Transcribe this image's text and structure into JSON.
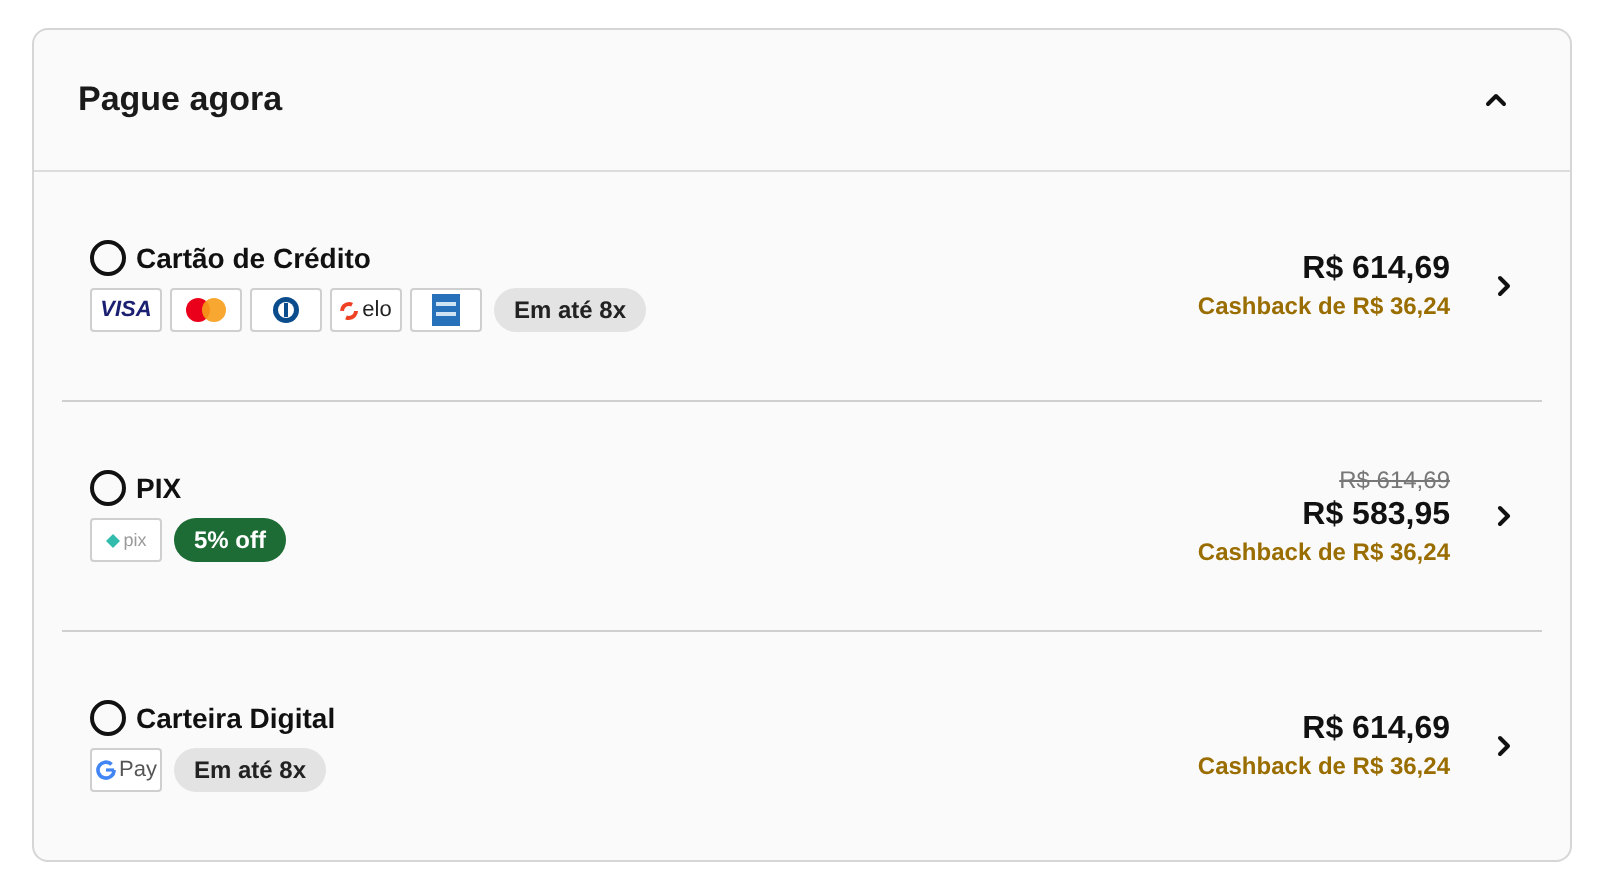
{
  "panel": {
    "title": "Pague agora",
    "expanded": true
  },
  "methods": [
    {
      "name": "Cartão de Crédito",
      "selected": false,
      "logos": [
        {
          "kind": "visa",
          "text": "VISA"
        },
        {
          "kind": "mastercard"
        },
        {
          "kind": "diners"
        },
        {
          "kind": "elo",
          "text": "elo"
        },
        {
          "kind": "amex"
        }
      ],
      "badges": [
        {
          "kind": "installments",
          "text": "Em até 8x"
        }
      ],
      "price": "R$ 614,69",
      "cashback": "Cashback de R$ 36,24"
    },
    {
      "name": "PIX",
      "selected": false,
      "logos": [
        {
          "kind": "pix",
          "text": "pix"
        }
      ],
      "badges": [
        {
          "kind": "discount",
          "text": "5% off"
        }
      ],
      "old_price": "R$ 614,69",
      "price": "R$ 583,95",
      "cashback": "Cashback de R$ 36,24"
    },
    {
      "name": "Carteira Digital",
      "selected": false,
      "logos": [
        {
          "kind": "gpay",
          "text": "Pay"
        }
      ],
      "badges": [
        {
          "kind": "installments",
          "text": "Em até 8x"
        }
      ],
      "price": "R$ 614,69",
      "cashback": "Cashback de R$ 36,24"
    }
  ]
}
